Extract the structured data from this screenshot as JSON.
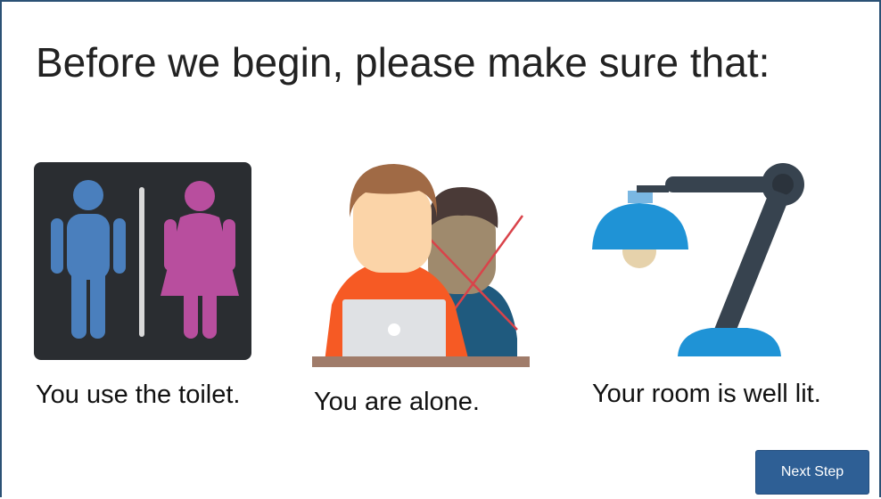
{
  "header": {
    "title": "Before we begin, please make sure that:"
  },
  "checklist": [
    {
      "caption": "You use the toilet.",
      "icon": "toilet-sign-icon"
    },
    {
      "caption": "You are alone.",
      "icon": "alone-person-icon"
    },
    {
      "caption": "Your room is well lit.",
      "icon": "desk-lamp-icon"
    }
  ],
  "footer": {
    "next_label": "Next Step"
  },
  "colors": {
    "frame_border": "#2b5175",
    "button_bg": "#2e5f95",
    "male_blue": "#4a7fbd",
    "female_magenta": "#b84e9e",
    "shirt_orange": "#f65a24",
    "lamp_blue": "#1f93d6"
  }
}
